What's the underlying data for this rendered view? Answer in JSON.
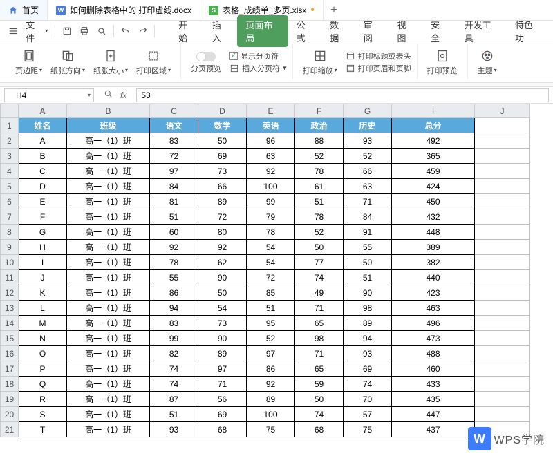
{
  "tabs": {
    "home": "首页",
    "doc": "如何删除表格中的 打印虚线.docx",
    "xlsx": "表格_成绩单_多页.xlsx",
    "plus": "+"
  },
  "toolbar": {
    "file": "文件",
    "menus": [
      "开始",
      "插入",
      "页面布局",
      "公式",
      "数据",
      "审阅",
      "视图",
      "安全",
      "开发工具",
      "特色功"
    ],
    "active": 2
  },
  "ribbon": {
    "margins": "页边距",
    "orientation": "纸张方向",
    "size": "纸张大小",
    "printArea": "打印区域",
    "breakPreview": "分页预览",
    "showBreaks": "显示分页符",
    "insertBreak": "插入分页符",
    "printScale": "打印缩放",
    "printTitles": "打印标题或表头",
    "printHF": "打印页眉和页脚",
    "printPreview": "打印预览",
    "theme": "主题"
  },
  "fbar": {
    "cell": "H4",
    "fx": "fx",
    "value": "53"
  },
  "columns": [
    "A",
    "B",
    "C",
    "D",
    "E",
    "F",
    "G",
    "I",
    "J"
  ],
  "header": [
    "姓名",
    "班级",
    "语文",
    "数学",
    "英语",
    "政治",
    "历史",
    "总分"
  ],
  "classLabel": "高一（1）班",
  "rows": [
    [
      "A",
      83,
      50,
      96,
      88,
      93,
      492
    ],
    [
      "B",
      72,
      69,
      63,
      52,
      52,
      365
    ],
    [
      "C",
      97,
      73,
      92,
      78,
      66,
      459
    ],
    [
      "D",
      84,
      66,
      100,
      61,
      63,
      424
    ],
    [
      "E",
      81,
      89,
      99,
      51,
      71,
      450
    ],
    [
      "F",
      51,
      72,
      79,
      78,
      84,
      432
    ],
    [
      "G",
      60,
      80,
      78,
      52,
      91,
      448
    ],
    [
      "H",
      92,
      92,
      54,
      50,
      55,
      389
    ],
    [
      "I",
      78,
      62,
      54,
      77,
      50,
      382
    ],
    [
      "J",
      55,
      90,
      72,
      74,
      51,
      440
    ],
    [
      "K",
      86,
      50,
      85,
      49,
      90,
      423
    ],
    [
      "L",
      94,
      54,
      51,
      71,
      98,
      463
    ],
    [
      "M",
      83,
      73,
      95,
      65,
      89,
      496
    ],
    [
      "N",
      99,
      90,
      52,
      98,
      94,
      473
    ],
    [
      "O",
      82,
      89,
      97,
      71,
      93,
      488
    ],
    [
      "P",
      74,
      97,
      86,
      65,
      69,
      460
    ],
    [
      "Q",
      74,
      71,
      92,
      59,
      74,
      433
    ],
    [
      "R",
      87,
      56,
      89,
      50,
      70,
      435
    ],
    [
      "S",
      51,
      69,
      100,
      74,
      57,
      447
    ],
    [
      "T",
      93,
      68,
      75,
      68,
      75,
      437
    ]
  ],
  "watermark": {
    "logo": "W",
    "text": "WPS学院"
  }
}
